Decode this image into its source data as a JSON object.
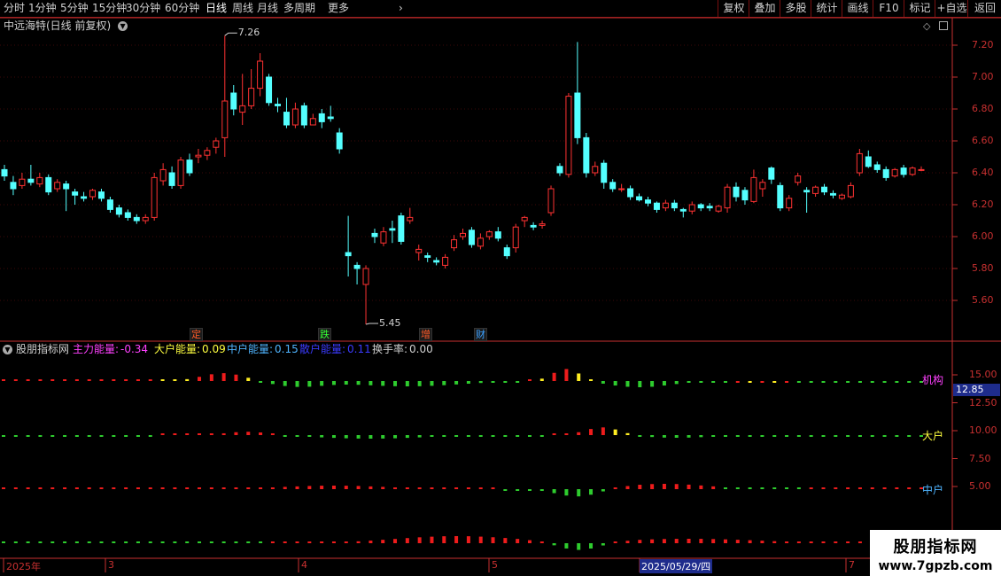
{
  "toolbar": {
    "periods": [
      "分时",
      "1分钟",
      "5分钟",
      "15分钟",
      "30分钟",
      "60分钟",
      "日线",
      "周线",
      "月线",
      "多周期",
      "更多"
    ],
    "active_period": "日线",
    "buttons": [
      "复权",
      "叠加",
      "多股",
      "统计",
      "画线",
      "F10",
      "标记",
      "+自选",
      "返回"
    ]
  },
  "chart": {
    "title": "中远海特(日线 前复权)",
    "price_axis": [
      "7.20",
      "7.00",
      "6.80",
      "6.60",
      "6.40",
      "6.20",
      "6.00",
      "5.80",
      "5.60"
    ],
    "max_label": "7.26",
    "min_label": "5.45",
    "event_markers": [
      {
        "text": "定",
        "color": "#ff5a28"
      },
      {
        "text": "跌",
        "color": "#33ff33"
      },
      {
        "text": "增",
        "color": "#ff5a28"
      },
      {
        "text": "财",
        "color": "#3aa0ff"
      }
    ],
    "colors": {
      "up": "#ff3232",
      "down": "#54ffff",
      "grid": "#5a0a0a",
      "axis": "#c83030"
    }
  },
  "indicator": {
    "name": "股朋指标网",
    "items": [
      {
        "label": "主力能量:",
        "value": "-0.34",
        "color": "#ff40ff"
      },
      {
        "label": "大户能量:",
        "value": "0.09",
        "color": "#ffff40"
      },
      {
        "label": "中户能量:",
        "value": "0.15",
        "color": "#4fb4ff"
      },
      {
        "label": "散户能量:",
        "value": "0.11",
        "color": "#3b3bff"
      },
      {
        "label": "换手率:",
        "value": "0.00",
        "color": "#d0d0d0"
      }
    ],
    "axis": [
      "15.00",
      "12.50",
      "10.00",
      "7.50",
      "5.00"
    ],
    "current_value": "12.85",
    "right_labels": [
      {
        "text": "机构",
        "color": "#ff40ff"
      },
      {
        "text": "大户",
        "color": "#ffff40"
      },
      {
        "text": "中户",
        "color": "#4fb4ff"
      }
    ]
  },
  "dates": [
    "2025年",
    "3",
    "4",
    "5",
    "2025/05/29/四",
    "7"
  ],
  "watermark": {
    "title": "股朋指标网",
    "url": "www.7gpzb.com"
  },
  "chart_data": {
    "type": "candlestick",
    "title": "中远海特(日线 前复权)",
    "ylim": [
      5.45,
      7.26
    ],
    "candles": [
      [
        6.42,
        6.38,
        6.45,
        6.35
      ],
      [
        6.34,
        6.3,
        6.38,
        6.26
      ],
      [
        6.32,
        6.36,
        6.4,
        6.3
      ],
      [
        6.36,
        6.34,
        6.45,
        6.32
      ],
      [
        6.33,
        6.37,
        6.4,
        6.31
      ],
      [
        6.37,
        6.28,
        6.39,
        6.26
      ],
      [
        6.3,
        6.34,
        6.36,
        6.28
      ],
      [
        6.33,
        6.3,
        6.35,
        6.16
      ],
      [
        6.28,
        6.26,
        6.3,
        6.2
      ],
      [
        6.25,
        6.24,
        6.28,
        6.22
      ],
      [
        6.25,
        6.29,
        6.3,
        6.23
      ],
      [
        6.28,
        6.24,
        6.3,
        6.22
      ],
      [
        6.23,
        6.17,
        6.25,
        6.15
      ],
      [
        6.18,
        6.14,
        6.2,
        6.12
      ],
      [
        6.15,
        6.12,
        6.17,
        6.1
      ],
      [
        6.12,
        6.1,
        6.14,
        6.08
      ],
      [
        6.1,
        6.12,
        6.14,
        6.08
      ],
      [
        6.12,
        6.37,
        6.4,
        6.1
      ],
      [
        6.35,
        6.42,
        6.46,
        6.32
      ],
      [
        6.4,
        6.32,
        6.44,
        6.3
      ],
      [
        6.32,
        6.48,
        6.5,
        6.3
      ],
      [
        6.48,
        6.4,
        6.52,
        6.38
      ],
      [
        6.5,
        6.51,
        6.55,
        6.46
      ],
      [
        6.51,
        6.54,
        6.56,
        6.48
      ],
      [
        6.56,
        6.6,
        6.62,
        6.52
      ],
      [
        6.62,
        6.85,
        7.26,
        6.5
      ],
      [
        6.9,
        6.8,
        6.95,
        6.76
      ],
      [
        6.78,
        6.82,
        7.02,
        6.7
      ],
      [
        6.82,
        6.93,
        7.05,
        6.8
      ],
      [
        6.93,
        7.1,
        7.15,
        6.88
      ],
      [
        7.0,
        6.84,
        7.02,
        6.82
      ],
      [
        6.83,
        6.82,
        6.87,
        6.78
      ],
      [
        6.78,
        6.7,
        6.87,
        6.68
      ],
      [
        6.7,
        6.8,
        6.84,
        6.68
      ],
      [
        6.82,
        6.7,
        6.84,
        6.68
      ],
      [
        6.7,
        6.74,
        6.77,
        6.7
      ],
      [
        6.77,
        6.72,
        6.8,
        6.68
      ],
      [
        6.75,
        6.74,
        6.82,
        6.72
      ],
      [
        6.65,
        6.55,
        6.68,
        6.52
      ],
      [
        5.9,
        5.88,
        6.13,
        5.75
      ],
      [
        5.82,
        5.8,
        5.84,
        5.7
      ],
      [
        5.7,
        5.8,
        5.82,
        5.45
      ],
      [
        6.02,
        6.0,
        6.05,
        5.96
      ],
      [
        5.96,
        6.03,
        6.06,
        5.94
      ],
      [
        6.05,
        6.04,
        6.1,
        5.96
      ],
      [
        6.13,
        5.97,
        6.15,
        5.95
      ],
      [
        6.1,
        6.12,
        6.18,
        6.08
      ],
      [
        5.9,
        5.92,
        5.95,
        5.85
      ],
      [
        5.88,
        5.87,
        5.9,
        5.84
      ],
      [
        5.85,
        5.84,
        5.87,
        5.82
      ],
      [
        5.82,
        5.87,
        5.89,
        5.8
      ],
      [
        5.93,
        5.98,
        6.01,
        5.91
      ],
      [
        6.0,
        6.02,
        6.05,
        5.98
      ],
      [
        6.04,
        5.95,
        6.06,
        5.93
      ],
      [
        5.94,
        5.99,
        6.02,
        5.92
      ],
      [
        6.0,
        6.03,
        6.04,
        5.98
      ],
      [
        6.03,
        5.99,
        6.06,
        5.97
      ],
      [
        5.93,
        5.88,
        5.95,
        5.86
      ],
      [
        5.93,
        6.06,
        6.08,
        5.9
      ],
      [
        6.1,
        6.12,
        6.13,
        6.06
      ],
      [
        6.07,
        6.06,
        6.09,
        6.04
      ],
      [
        6.07,
        6.08,
        6.1,
        6.05
      ],
      [
        6.15,
        6.3,
        6.32,
        6.13
      ],
      [
        6.44,
        6.4,
        6.46,
        6.38
      ],
      [
        6.39,
        6.88,
        6.9,
        6.37
      ],
      [
        6.9,
        6.62,
        7.22,
        6.58
      ],
      [
        6.62,
        6.4,
        6.65,
        6.37
      ],
      [
        6.4,
        6.44,
        6.47,
        6.38
      ],
      [
        6.46,
        6.34,
        6.48,
        6.3
      ],
      [
        6.34,
        6.3,
        6.36,
        6.28
      ],
      [
        6.3,
        6.3,
        6.33,
        6.28
      ],
      [
        6.3,
        6.25,
        6.32,
        6.23
      ],
      [
        6.25,
        6.23,
        6.27,
        6.22
      ],
      [
        6.23,
        6.21,
        6.25,
        6.19
      ],
      [
        6.21,
        6.17,
        6.22,
        6.15
      ],
      [
        6.18,
        6.21,
        6.23,
        6.16
      ],
      [
        6.21,
        6.18,
        6.23,
        6.16
      ],
      [
        6.17,
        6.16,
        6.18,
        6.12
      ],
      [
        6.16,
        6.2,
        6.22,
        6.14
      ],
      [
        6.2,
        6.18,
        6.21,
        6.16
      ],
      [
        6.19,
        6.18,
        6.21,
        6.16
      ],
      [
        6.16,
        6.19,
        6.2,
        6.15
      ],
      [
        6.18,
        6.31,
        6.33,
        6.15
      ],
      [
        6.31,
        6.25,
        6.34,
        6.22
      ],
      [
        6.29,
        6.23,
        6.31,
        6.2
      ],
      [
        6.22,
        6.37,
        6.42,
        6.21
      ],
      [
        6.3,
        6.34,
        6.36,
        6.25
      ],
      [
        6.43,
        6.36,
        6.44,
        6.33
      ],
      [
        6.32,
        6.18,
        6.34,
        6.16
      ],
      [
        6.18,
        6.24,
        6.26,
        6.16
      ],
      [
        6.34,
        6.38,
        6.4,
        6.32
      ],
      [
        6.29,
        6.28,
        6.31,
        6.15
      ],
      [
        6.27,
        6.31,
        6.32,
        6.25
      ],
      [
        6.31,
        6.28,
        6.33,
        6.26
      ],
      [
        6.27,
        6.26,
        6.29,
        6.24
      ],
      [
        6.24,
        6.26,
        6.27,
        6.23
      ],
      [
        6.25,
        6.32,
        6.34,
        6.24
      ],
      [
        6.4,
        6.52,
        6.55,
        6.38
      ],
      [
        6.5,
        6.44,
        6.54,
        6.43
      ],
      [
        6.45,
        6.42,
        6.47,
        6.4
      ],
      [
        6.42,
        6.37,
        6.44,
        6.35
      ],
      [
        6.38,
        6.42,
        6.43,
        6.37
      ],
      [
        6.43,
        6.39,
        6.45,
        6.37
      ],
      [
        6.39,
        6.43,
        6.44,
        6.38
      ],
      [
        6.42,
        6.42,
        6.44,
        6.41
      ]
    ]
  }
}
